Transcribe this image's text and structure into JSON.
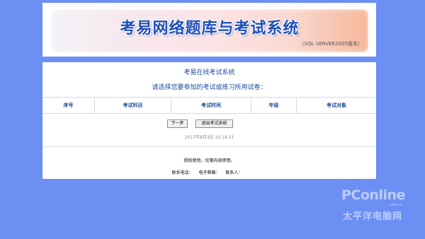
{
  "banner": {
    "title": "考易网络题库与考试系统",
    "subtitle": "（SQL SERVER2005版本）"
  },
  "main": {
    "title": "考易在线考试系统",
    "subtitle": "请选择您要参加的考试或练习所用试卷：",
    "table_headers": [
      "序号",
      "考试科目",
      "考试时间",
      "年级",
      "考试对象"
    ],
    "buttons": {
      "next": "下一步",
      "exit": "退出考试系统"
    },
    "datetime": "2017年8月3日 10:14:21",
    "notice": "授权使用，仅限内部使用。",
    "contact": {
      "phone": "联系电话：",
      "email": "电子邮箱：",
      "person": "联系人："
    }
  },
  "watermark": {
    "logo": "PConline",
    "chinese": "太平洋电脑网",
    "url": ".com.cn"
  },
  "colors": {
    "background": "#6b8ff3",
    "title_blue": "#1c4d9c",
    "banner_text": "#1e4fb8"
  }
}
